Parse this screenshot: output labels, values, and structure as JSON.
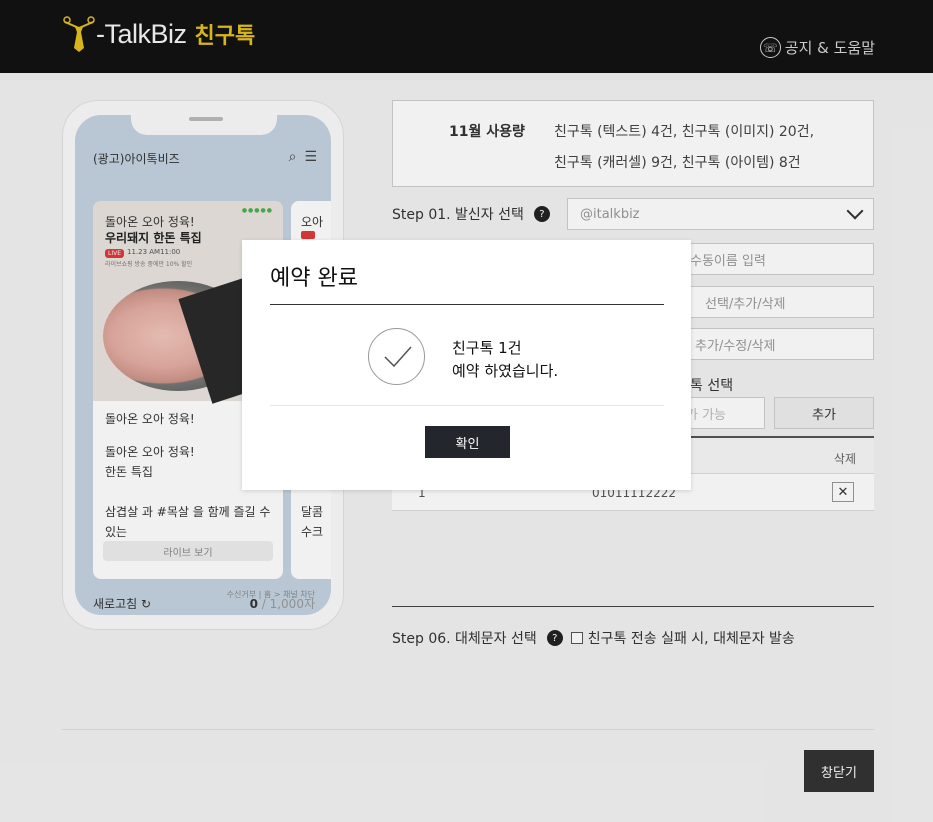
{
  "header": {
    "logo_text": "-TalkBiz",
    "logo_kr": "친구톡",
    "help_label": "공지 & 도움말",
    "help_icon": "phone-icon"
  },
  "phone": {
    "channel_title": "(광고)아이톡비즈",
    "card": {
      "headline1": "돌아온 오아 정육!",
      "headline2": "우리돼지 한돈 특집",
      "live_badge": "LIVE",
      "live_time": "11.23 AM11:00",
      "live_sub": "라이브쇼핑 방송 중에만 10% 할인",
      "text1": "돌아온 오아 정육!",
      "text2": "돌아온 오아 정육!",
      "text3": "한돈 특집",
      "text4": "삼겹살 과 #목살 을 함께 즐길 수 있는",
      "button": "라이브 보기"
    },
    "side_card": {
      "title": "오아",
      "text1": "달콤",
      "text2": "수크"
    },
    "footer_note": "수신거부 | 홈 > 채널 차단",
    "refresh_label": "새로고침",
    "count": "0",
    "count_max": " / 1,000자"
  },
  "usage": {
    "label": "11월 사용량",
    "line1": "친구톡 (텍스트) 4건, 친구톡 (이미지) 20건,",
    "line2": "친구톡 (캐러셀) 9건, 친구톡 (아이템) 8건"
  },
  "step1": {
    "label": "Step 01. 발신자 선택",
    "select_value": "@italkbiz"
  },
  "fields": {
    "f1": "수동이름 입력",
    "f2": "선택/추가/삭제",
    "f3": "추가/수정/삭제",
    "recipient_label": "톡 선택",
    "recipient_placeholder": "가 가능",
    "add_button": "추가"
  },
  "table": {
    "del_header": "삭제",
    "rows": [
      {
        "no": "1",
        "number": "01011112222"
      }
    ]
  },
  "step6": {
    "label": "Step 06. 대체문자 선택",
    "checkbox_label": "친구톡 전송 실패 시, 대체문자 발송"
  },
  "close_button": "창닫기",
  "modal": {
    "title": "예약 완료",
    "message1": "친구톡 1건",
    "message2": "예약 하였습니다.",
    "ok_button": "확인"
  }
}
